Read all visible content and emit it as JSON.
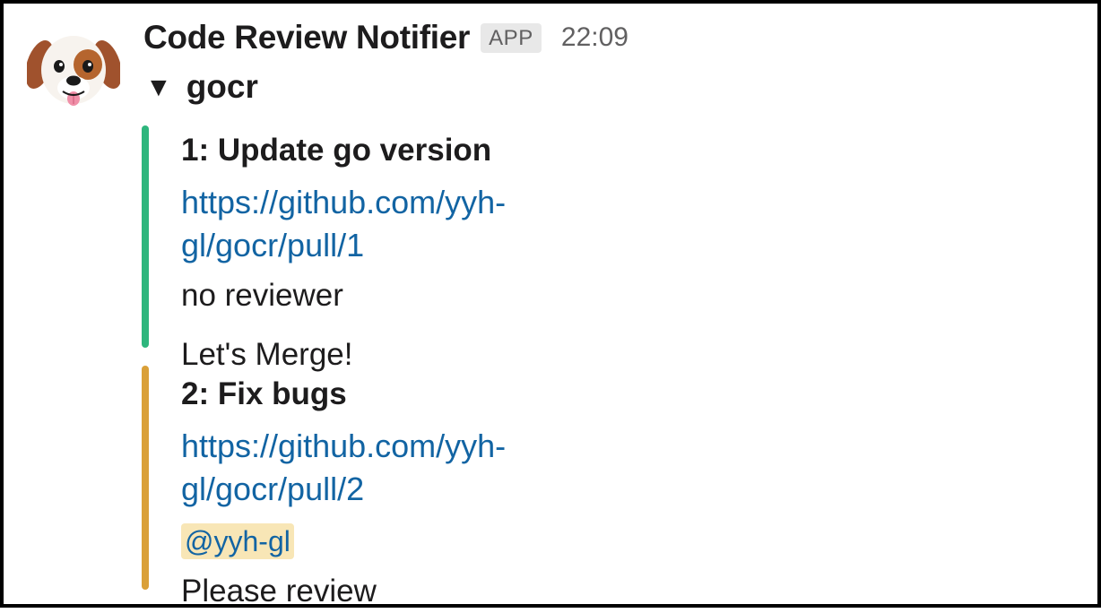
{
  "message": {
    "sender": "Code Review Notifier",
    "badge": "APP",
    "time": "22:09",
    "avatar_icon": "puppy-face-icon",
    "repo": "gocr",
    "collapse_icon": "triangle-down-icon"
  },
  "attachments": [
    {
      "title": "1: Update go version",
      "link": "https://github.com/yyh-gl/gocr/pull/1",
      "reviewer": "no reviewer",
      "status": "Let's Merge!",
      "bar_color": "#2eb67d"
    },
    {
      "title": "2: Fix bugs",
      "link": "https://github.com/yyh-gl/gocr/pull/2",
      "reviewer": "@yyh-gl",
      "status": "Please review",
      "bar_color": "#daa038"
    }
  ],
  "colors": {
    "link": "#1264a3",
    "mention_bg": "#f8e6b6",
    "badge_bg": "#e8e8e8"
  }
}
